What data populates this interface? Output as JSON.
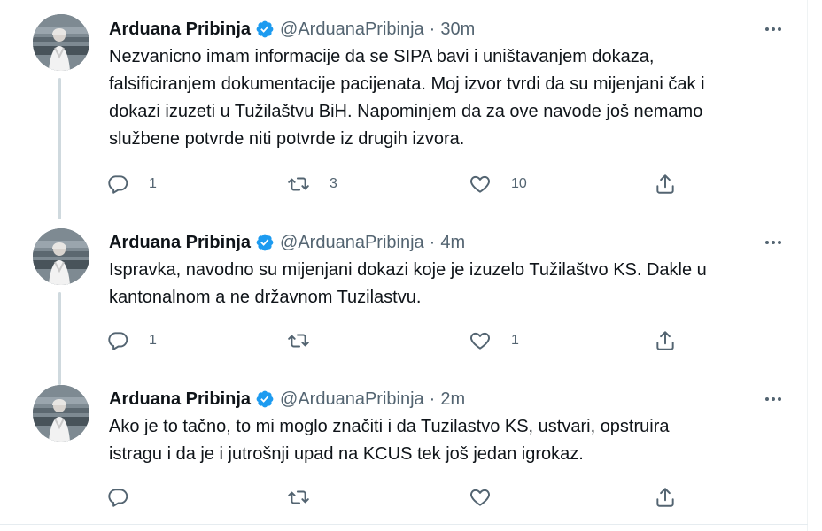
{
  "thread": {
    "tweets": [
      {
        "name": "Arduana Pribinja",
        "handle": "@ArduanaPribinja",
        "separator": "·",
        "time": "30m",
        "text": "Nezvanicno imam informacije da se SIPA bavi i uništavanjem dokaza,\nfalsificiranjem dokumentacije pacijenata. Moj izvor tvrdi da su mijenjani čak i\ndokazi izuzeti u Tužilaštvu BiH. Napominjem da za ove navode još nemamo\nslužbene potvrde niti potvrde iz drugih izvora.",
        "replies": "1",
        "retweets": "3",
        "likes": "10"
      },
      {
        "name": "Arduana Pribinja",
        "handle": "@ArduanaPribinja",
        "separator": "·",
        "time": "4m",
        "text": "Ispravka, navodno su mijenjani dokazi koje je izuzelo Tužilaštvo KS. Dakle u\nkantonalnom a ne državnom Tuzilastvu.",
        "replies": "1",
        "retweets": "",
        "likes": "1"
      },
      {
        "name": "Arduana Pribinja",
        "handle": "@ArduanaPribinja",
        "separator": "·",
        "time": "2m",
        "text": "Ako je to tačno, to mi moglo značiti i da Tuzilastvo KS, ustvari, opstruira\nistragu i da je i jutrošnji upad na KCUS tek još jedan igrokaz.",
        "replies": "",
        "retweets": "",
        "likes": ""
      }
    ]
  },
  "colors": {
    "text": "#0f1419",
    "secondary": "#536471",
    "verified": "#1d9bf0",
    "thread_line": "#cfd9de",
    "border": "#eff3f4"
  },
  "icons": {
    "verified": "verified-badge-icon",
    "more": "more-options-icon",
    "reply": "reply-icon",
    "retweet": "retweet-icon",
    "like": "heart-icon",
    "share": "share-icon"
  }
}
